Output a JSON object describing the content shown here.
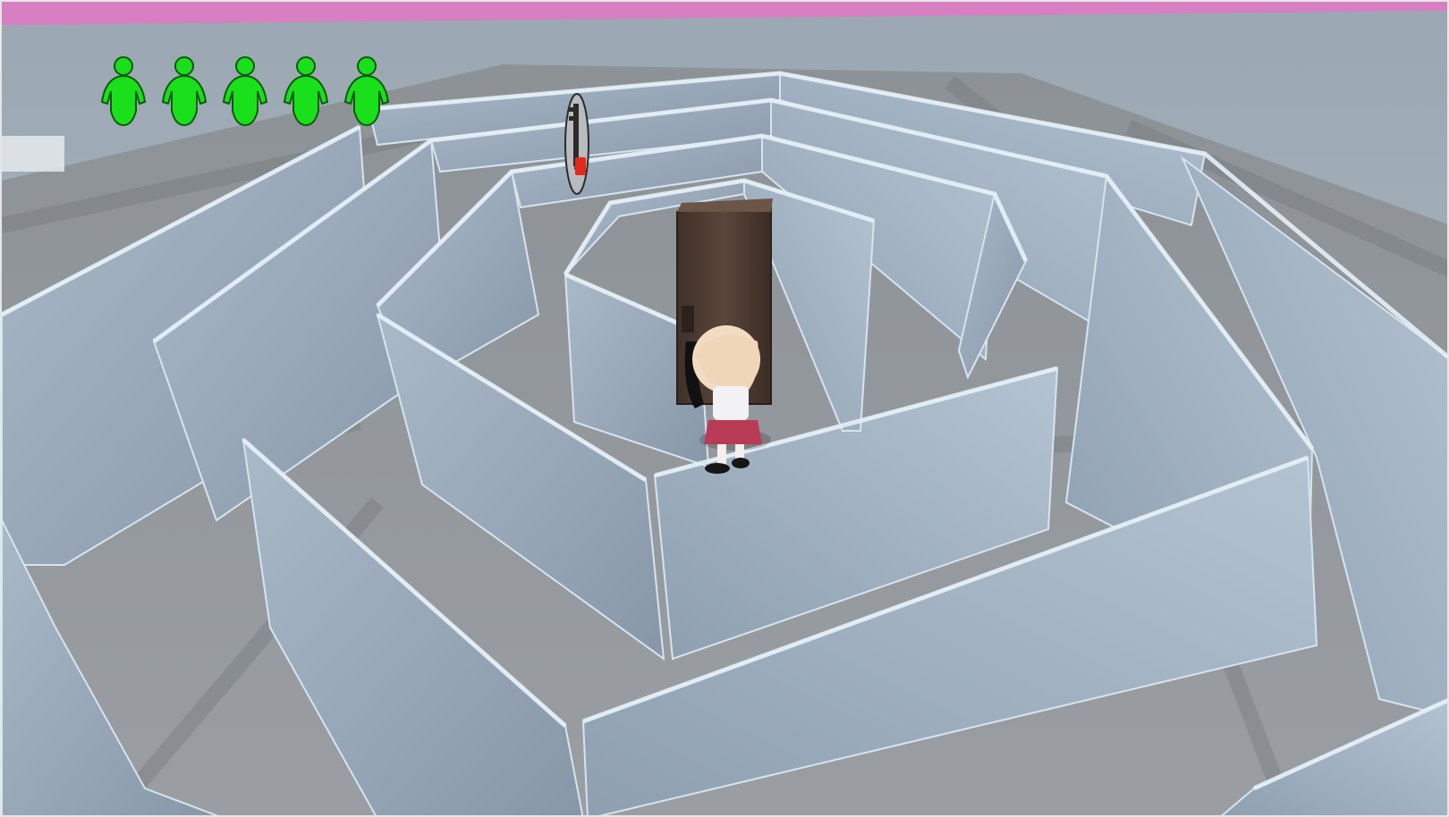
{
  "game": {
    "genre": "3d-maze",
    "camera": "third-person-overhead"
  },
  "hud": {
    "lives": {
      "count": 5,
      "icon": "person-silhouette-icon",
      "color": "#19e01b",
      "outline": "#0b5b0c"
    },
    "objective_marker": {
      "icon": "key-on-ring-icon",
      "accent": "#e02a1a"
    }
  },
  "scene": {
    "colors": {
      "sky": "#9aa6b0",
      "floor": "#8f9498",
      "floor_dark": "#6f7478",
      "wall_face": "#9fb0c0",
      "wall_face_dark": "#8496a8",
      "wall_top": "#d6e4ef",
      "pink_border": "#d77fc2",
      "door": "#4e3c32"
    },
    "objects": [
      "maze-walls",
      "central-door",
      "player-character"
    ]
  }
}
